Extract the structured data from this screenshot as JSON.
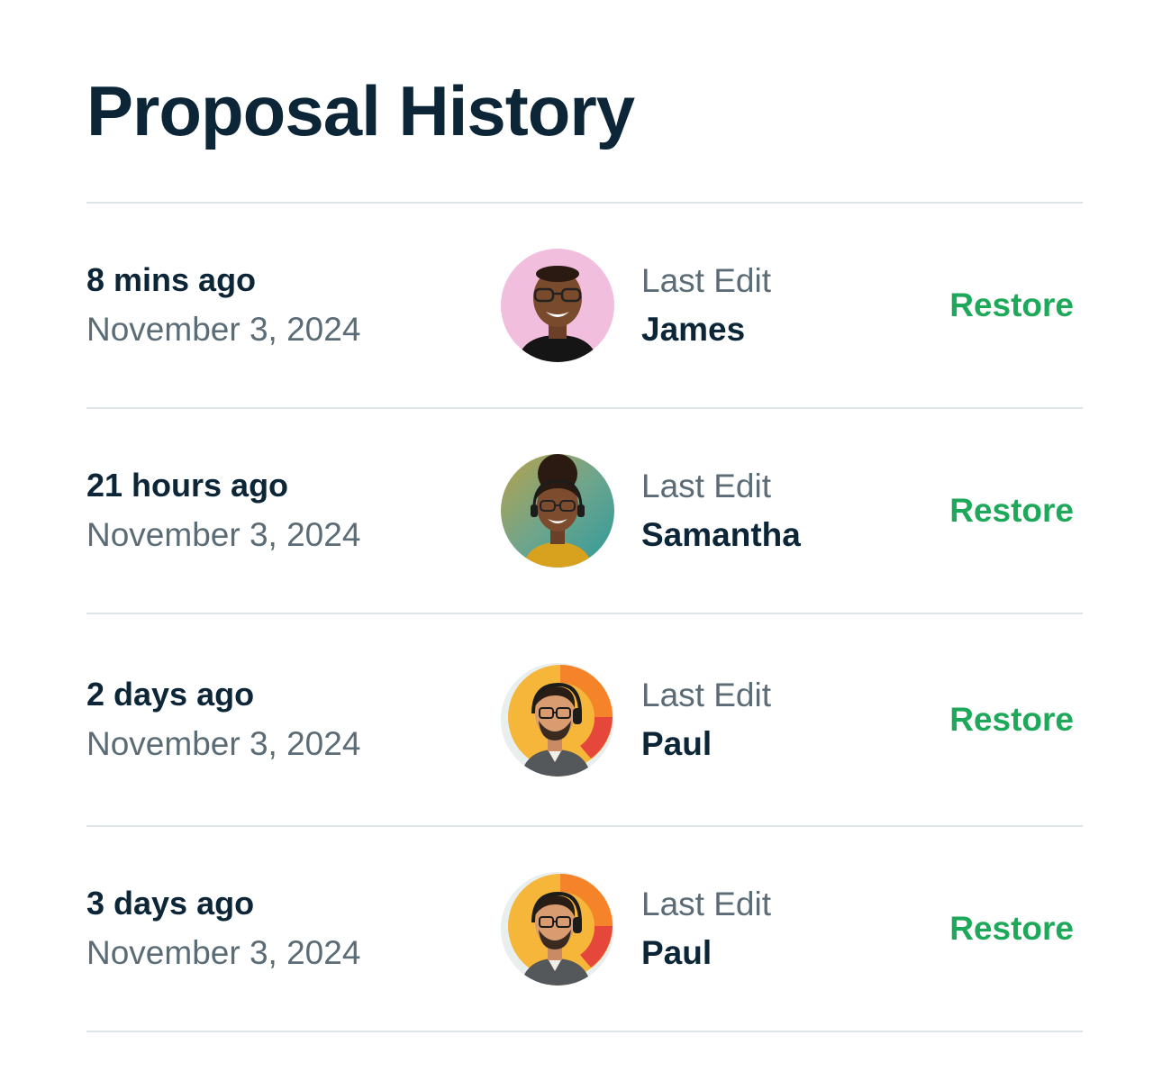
{
  "page": {
    "title": "Proposal History"
  },
  "history": [
    {
      "relative": "8 mins ago",
      "date": "November 3, 2024",
      "label": "Last Edit",
      "editor": "James",
      "action": "Restore"
    },
    {
      "relative": "21 hours ago",
      "date": "November 3, 2024",
      "label": "Last Edit",
      "editor": "Samantha",
      "action": "Restore"
    },
    {
      "relative": "2 days ago",
      "date": "November 3, 2024",
      "label": "Last Edit",
      "editor": "Paul",
      "action": "Restore"
    },
    {
      "relative": "3 days ago",
      "date": "November 3, 2024",
      "label": "Last Edit",
      "editor": "Paul",
      "action": "Restore"
    }
  ],
  "colors": {
    "heading": "#0c2638",
    "muted": "#5b6c76",
    "accent": "#1ea95a",
    "divider": "#dde5e8"
  },
  "icons": {
    "avatar_james": "avatar-photo",
    "avatar_samantha": "avatar-photo",
    "avatar_paul": "avatar-photo"
  }
}
